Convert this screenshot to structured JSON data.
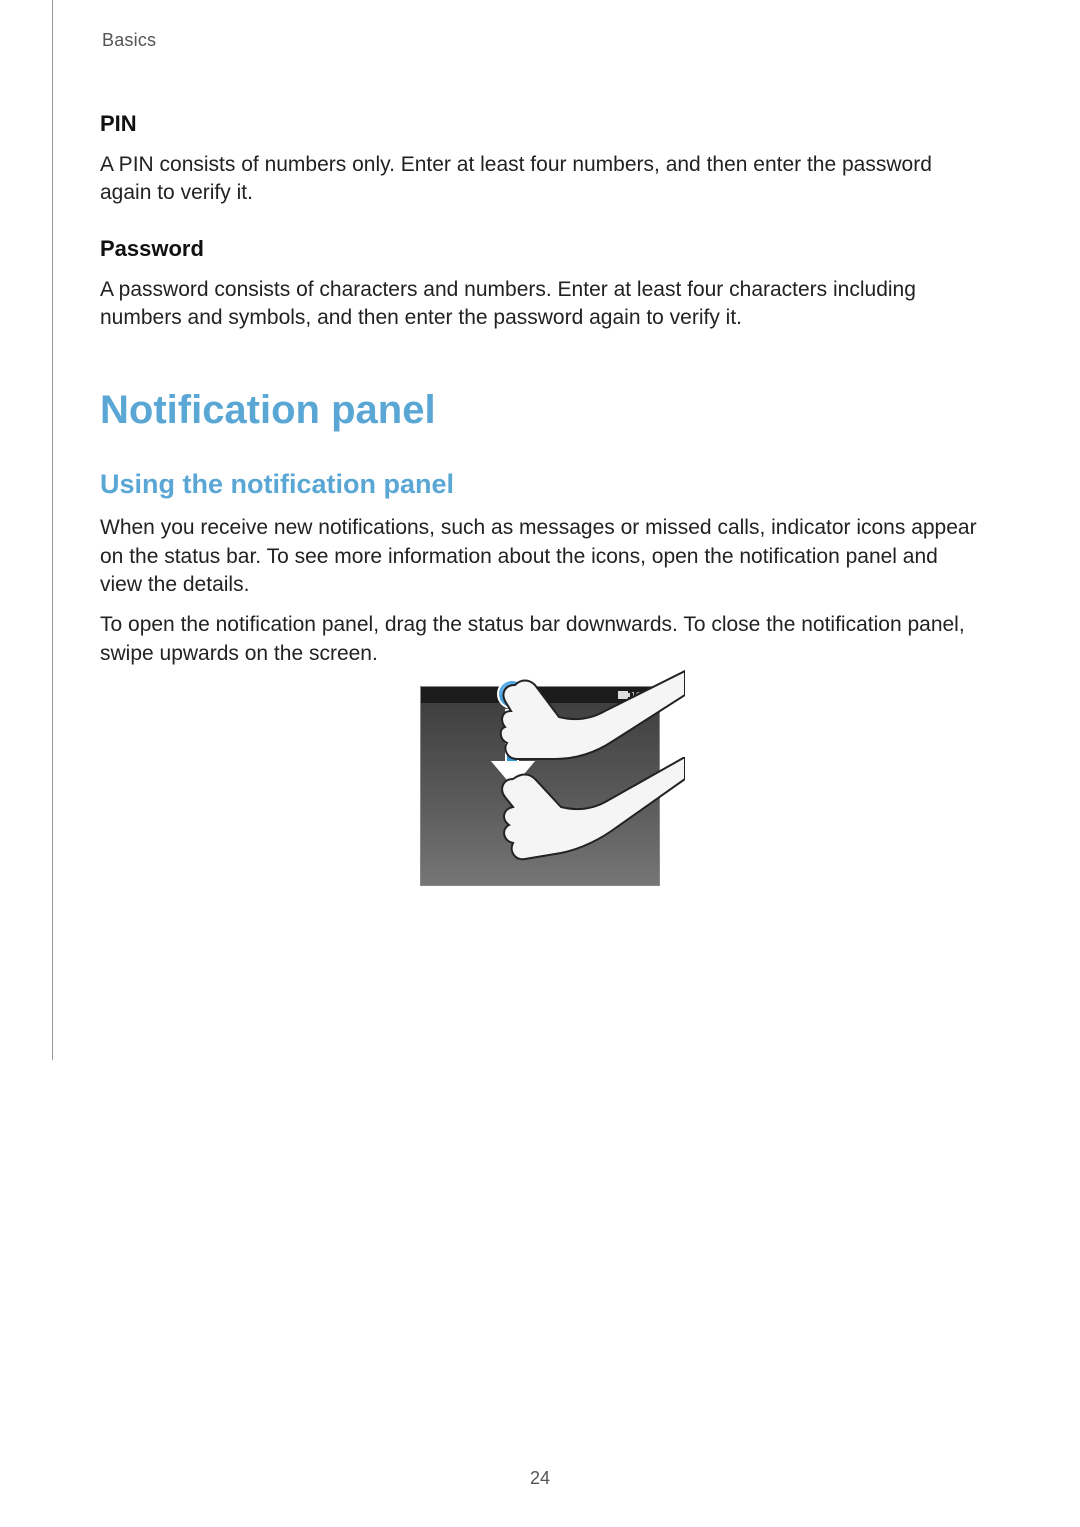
{
  "chapter": "Basics",
  "pin": {
    "heading": "PIN",
    "body": "A PIN consists of numbers only. Enter at least four numbers, and then enter the password again to verify it."
  },
  "password": {
    "heading": "Password",
    "body": "A password consists of characters and numbers. Enter at least four characters including numbers and symbols, and then enter the password again to verify it."
  },
  "h1": "Notification panel",
  "h2": "Using the notification panel",
  "para1": "When you receive new notifications, such as messages or missed calls, indicator icons appear on the status bar. To see more information about the icons, open the notification panel and view the details.",
  "para2": "To open the notification panel, drag the status bar downwards. To close the notification panel, swipe upwards on the screen.",
  "statusbar_time": "10:00",
  "page_number": "24"
}
